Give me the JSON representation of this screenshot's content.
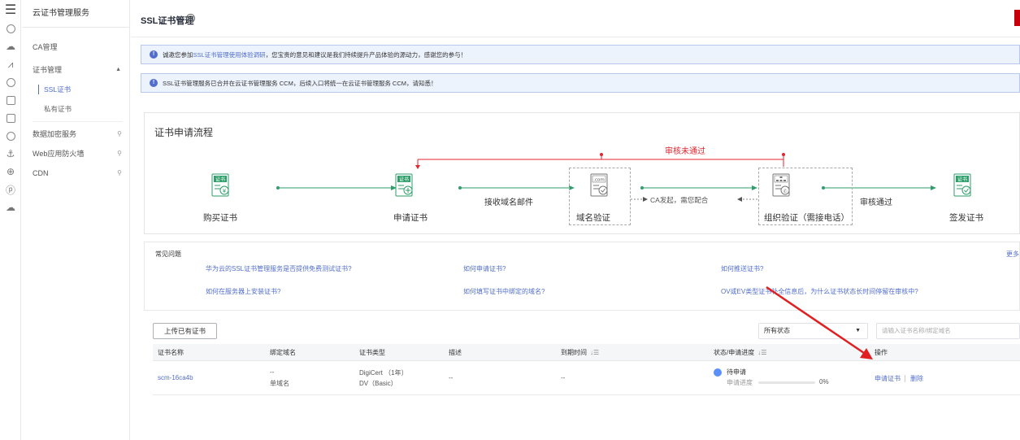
{
  "rail": {
    "icons": [
      "menu-icon",
      "cloud-server-icon",
      "cloud-icon",
      "chart-icon",
      "database-icon",
      "storage-icon",
      "document-icon",
      "circle-icon",
      "anchor-icon",
      "globe-icon",
      "p-icon",
      "cloud-outline-icon"
    ]
  },
  "sidebar": {
    "title": "云证书管理服务",
    "items": [
      {
        "label": "CA管理"
      },
      {
        "label": "证书管理",
        "expanded": true
      },
      {
        "label": "SSL证书",
        "active": true
      },
      {
        "label": "私有证书"
      },
      {
        "label": "数据加密服务",
        "link": true
      },
      {
        "label": "Web应用防火墙",
        "link": true
      },
      {
        "label": "CDN",
        "link": true
      }
    ]
  },
  "header": {
    "title": "SSL证书管理",
    "help": "?"
  },
  "notices": [
    {
      "pre": "诚邀您参加",
      "link": "SSL证书管理使用体验调研",
      "post": "，您宝贵的意见和建议是我们持续提升产品体验的源动力，感谢您的参与！"
    },
    {
      "pre": "SSL证书管理服务已合并在云证书管理服务 CCM，后续入口将统一在云证书管理服务 CCM，请知悉！",
      "link": "",
      "post": ""
    }
  ],
  "flow": {
    "title": "证书申请流程",
    "steps": [
      {
        "label": "购买证书",
        "icon_text": "证书",
        "icon": "certificate-yen-icon"
      },
      {
        "label": "申请证书",
        "icon_text": "证书",
        "icon": "certificate-plus-icon"
      },
      {
        "label": "域名验证",
        "icon_text": ".com",
        "icon": "domain-check-icon"
      },
      {
        "label": "组织验证（需接电话）",
        "icon_text": "",
        "icon": "org-phone-icon"
      },
      {
        "label": "签发证书",
        "icon_text": "证书",
        "icon": "certificate-check-icon"
      }
    ],
    "edges": [
      "接收域名邮件",
      "审核通过"
    ],
    "reject_label": "审核未通过",
    "ca_label": "CA发起，需您配合"
  },
  "faq": {
    "title": "常见问题",
    "more": "更多",
    "links": [
      "华为云的SSL证书管理服务是否提供免费测试证书?",
      "如何申请证书?",
      "如何推送证书?",
      "如何在服务器上安装证书?",
      "如何填写证书中绑定的域名?",
      "OV或EV类型证书补全信息后，为什么证书状态长时间停留在审核中?"
    ]
  },
  "toolbar": {
    "upload_label": "上传已有证书",
    "status_value": "所有状态",
    "search_placeholder": "请输入证书名称/绑定域名"
  },
  "table": {
    "columns": [
      "证书名称",
      "绑定域名",
      "证书类型",
      "描述",
      "到期时间",
      "状态/申请进度",
      "操作"
    ],
    "rows": [
      {
        "name": "scm-16ca4b",
        "domain_line1": "--",
        "domain_line2": "单域名",
        "type_line1": "DigiCert （1年）",
        "type_line2": "DV（Basic）",
        "description": "--",
        "expiry": "--",
        "status": "待申请",
        "progress_label": "申请进度",
        "progress_value": "0%",
        "progress": 0,
        "actions": [
          "申请证书",
          "删除"
        ]
      }
    ]
  },
  "colors": {
    "accent": "#526ecc",
    "danger": "#e0262f",
    "brand_red": "#c7000b",
    "icon_green": "#2e9e6b"
  }
}
